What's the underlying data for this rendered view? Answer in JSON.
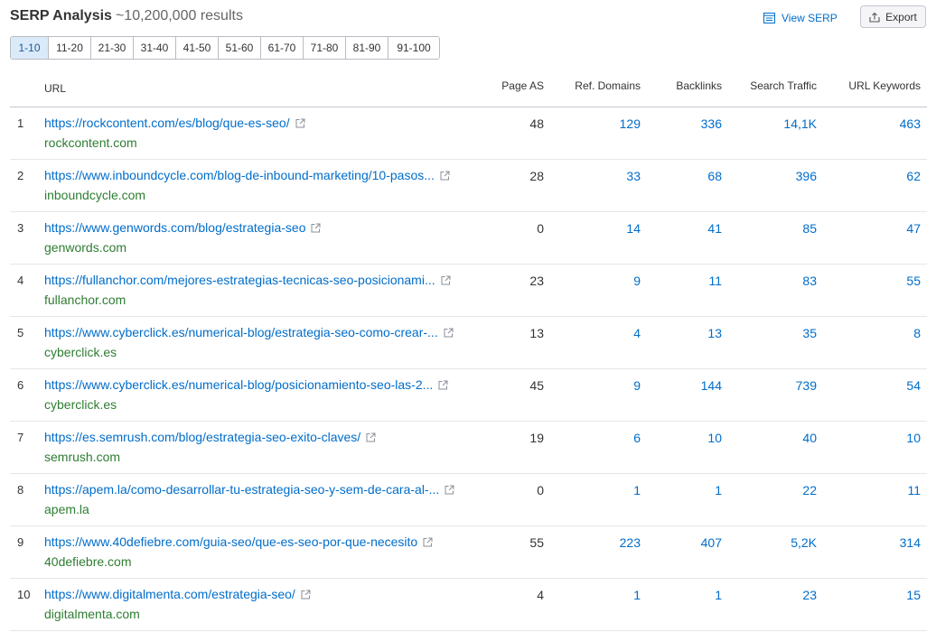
{
  "header": {
    "title": "SERP Analysis",
    "results": "~10,200,000 results",
    "view_serp": "View SERP",
    "export": "Export"
  },
  "pagination": [
    "1-10",
    "11-20",
    "21-30",
    "31-40",
    "41-50",
    "51-60",
    "61-70",
    "71-80",
    "81-90",
    "91-100"
  ],
  "table": {
    "columns": {
      "url": "URL",
      "page_as": "Page AS",
      "ref_domains": "Ref. Domains",
      "backlinks": "Backlinks",
      "search_traffic": "Search Traffic",
      "url_keywords": "URL Keywords"
    },
    "rows": [
      {
        "idx": "1",
        "url": "https://rockcontent.com/es/blog/que-es-seo/",
        "domain": "rockcontent.com",
        "page_as": "48",
        "ref_domains": "129",
        "backlinks": "336",
        "search_traffic": "14,1K",
        "url_keywords": "463"
      },
      {
        "idx": "2",
        "url": "https://www.inboundcycle.com/blog-de-inbound-marketing/10-pasos...",
        "domain": "inboundcycle.com",
        "page_as": "28",
        "ref_domains": "33",
        "backlinks": "68",
        "search_traffic": "396",
        "url_keywords": "62"
      },
      {
        "idx": "3",
        "url": "https://www.genwords.com/blog/estrategia-seo",
        "domain": "genwords.com",
        "page_as": "0",
        "ref_domains": "14",
        "backlinks": "41",
        "search_traffic": "85",
        "url_keywords": "47"
      },
      {
        "idx": "4",
        "url": "https://fullanchor.com/mejores-estrategias-tecnicas-seo-posicionami...",
        "domain": "fullanchor.com",
        "page_as": "23",
        "ref_domains": "9",
        "backlinks": "11",
        "search_traffic": "83",
        "url_keywords": "55"
      },
      {
        "idx": "5",
        "url": "https://www.cyberclick.es/numerical-blog/estrategia-seo-como-crear-...",
        "domain": "cyberclick.es",
        "page_as": "13",
        "ref_domains": "4",
        "backlinks": "13",
        "search_traffic": "35",
        "url_keywords": "8"
      },
      {
        "idx": "6",
        "url": "https://www.cyberclick.es/numerical-blog/posicionamiento-seo-las-2...",
        "domain": "cyberclick.es",
        "page_as": "45",
        "ref_domains": "9",
        "backlinks": "144",
        "search_traffic": "739",
        "url_keywords": "54"
      },
      {
        "idx": "7",
        "url": "https://es.semrush.com/blog/estrategia-seo-exito-claves/",
        "domain": "semrush.com",
        "page_as": "19",
        "ref_domains": "6",
        "backlinks": "10",
        "search_traffic": "40",
        "url_keywords": "10"
      },
      {
        "idx": "8",
        "url": "https://apem.la/como-desarrollar-tu-estrategia-seo-y-sem-de-cara-al-...",
        "domain": "apem.la",
        "page_as": "0",
        "ref_domains": "1",
        "backlinks": "1",
        "search_traffic": "22",
        "url_keywords": "11"
      },
      {
        "idx": "9",
        "url": "https://www.40defiebre.com/guia-seo/que-es-seo-por-que-necesito",
        "domain": "40defiebre.com",
        "page_as": "55",
        "ref_domains": "223",
        "backlinks": "407",
        "search_traffic": "5,2K",
        "url_keywords": "314"
      },
      {
        "idx": "10",
        "url": "https://www.digitalmenta.com/estrategia-seo/",
        "domain": "digitalmenta.com",
        "page_as": "4",
        "ref_domains": "1",
        "backlinks": "1",
        "search_traffic": "23",
        "url_keywords": "15"
      }
    ]
  },
  "colors": {
    "link": "#006dca",
    "domain": "#2e7d32",
    "active_page_bg": "#dbeaf8"
  },
  "icons": {
    "view_serp": "serp-list-icon",
    "export": "export-upload-icon",
    "row_link": "external-link-icon"
  }
}
